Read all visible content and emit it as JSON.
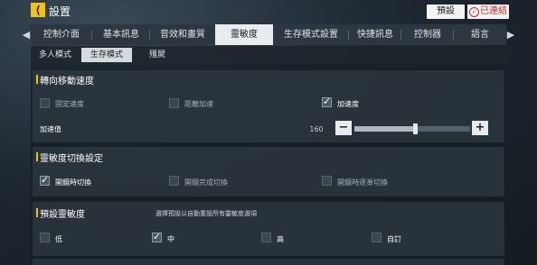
{
  "header": {
    "back_glyph": "⟨",
    "title": "設置",
    "default_btn": "預設",
    "saved_btn": "已連結",
    "saved_glyph": "✓"
  },
  "tabs": {
    "left_arrow": "◀",
    "right_arrow": "▶",
    "items": [
      "控制介面",
      "基本訊息",
      "音效和畫質",
      "靈敏度",
      "生存模式設置",
      "快捷訊息",
      "控制器",
      "語言"
    ],
    "active": "靈敏度"
  },
  "subtabs": {
    "items": [
      "多人模式",
      "生存模式",
      "殭屍"
    ],
    "active": "生存模式"
  },
  "rotation": {
    "title": "轉向移動速度",
    "options": [
      {
        "label": "固定速度",
        "checked": false
      },
      {
        "label": "距離加速",
        "checked": false
      },
      {
        "label": "加速度",
        "checked": true
      }
    ],
    "slider": {
      "label": "加速值",
      "value": "160",
      "minus": "−",
      "plus": "+",
      "fill_fraction": 0.52
    }
  },
  "switch": {
    "title": "靈敏度切換設定",
    "options": [
      {
        "label": "開鏡時切換",
        "checked": true
      },
      {
        "label": "開鏡完成切換",
        "checked": false
      },
      {
        "label": "開鏡時逐漸切換",
        "checked": false
      }
    ]
  },
  "preset": {
    "title": "預設靈敏度",
    "note": "選擇預設以自動重設所有靈敏度選項",
    "options": [
      {
        "label": "低",
        "checked": false
      },
      {
        "label": "中",
        "checked": true
      },
      {
        "label": "高",
        "checked": false
      },
      {
        "label": "自訂",
        "checked": false
      }
    ]
  }
}
